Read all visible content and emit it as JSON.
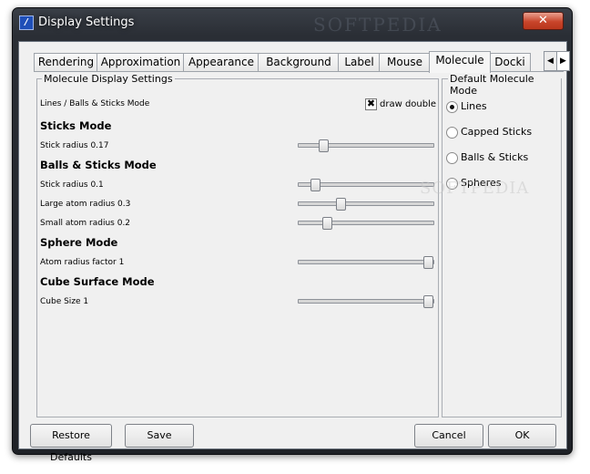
{
  "window": {
    "title": "Display Settings",
    "icon": "app-logo-icon",
    "close_glyph": "✕",
    "watermark_top": "SOFTPEDIA",
    "watermark_mid": "SOFTPEDIA"
  },
  "tabs": [
    "Rendering",
    "Approximation",
    "Appearance",
    "Background",
    "Label",
    "Mouse",
    "Molecule",
    "Docki"
  ],
  "scroll": {
    "left": "◀",
    "right": "▶"
  },
  "panel": {
    "title": "Molecule Display Settings",
    "lines_mode": "Lines / Balls & Sticks Mode",
    "draw_double_label": "draw double",
    "draw_double_checked": true,
    "sticks_heading": "Sticks Mode",
    "stick_radius_label": "Stick radius  0.17",
    "bs_heading": "Balls & Sticks Mode",
    "bs_stick_radius_label": "Stick radius  0.1",
    "large_atom_label": "Large atom radius  0.3",
    "small_atom_label": "Small atom radius  0.2",
    "sphere_heading": "Sphere Mode",
    "atom_factor_label": "Atom radius factor  1",
    "cube_heading": "Cube Surface Mode",
    "cube_size_label": "Cube Size  1",
    "sliders": {
      "stick_radius": 0.17,
      "bs_stick_radius": 0.05,
      "large_atom_radius": 0.3,
      "small_atom_radius": 0.2,
      "atom_radius_factor": 1.0,
      "cube_size": 1.0
    }
  },
  "default_mode": {
    "title": "Default Molecule Mode",
    "options": [
      "Lines",
      "Capped Sticks",
      "Balls & Sticks",
      "Spheres"
    ],
    "selected": "Lines"
  },
  "buttons": {
    "restore": "Restore Defaults",
    "save": "Save",
    "cancel": "Cancel",
    "ok": "OK"
  }
}
